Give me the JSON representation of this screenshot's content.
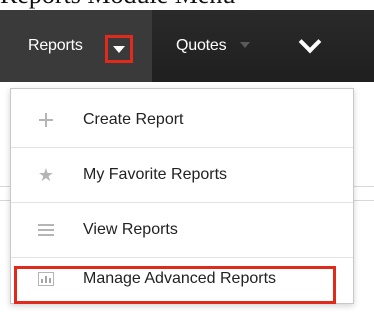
{
  "caption": "Reports Module Menu",
  "navbar": {
    "reports_label": "Reports",
    "quotes_label": "Quotes"
  },
  "menu": {
    "items": [
      {
        "label": "Create Report",
        "icon": "plus-icon"
      },
      {
        "label": "My Favorite Reports",
        "icon": "star-icon"
      },
      {
        "label": "View Reports",
        "icon": "list-icon"
      },
      {
        "label": "Manage Advanced Reports",
        "icon": "chart-icon"
      }
    ]
  },
  "colors": {
    "navbar_bg": "#222222",
    "active_tab_bg": "#3a3a3a",
    "highlight": "#e02a1c",
    "icon_gray": "#b5b5b5"
  }
}
